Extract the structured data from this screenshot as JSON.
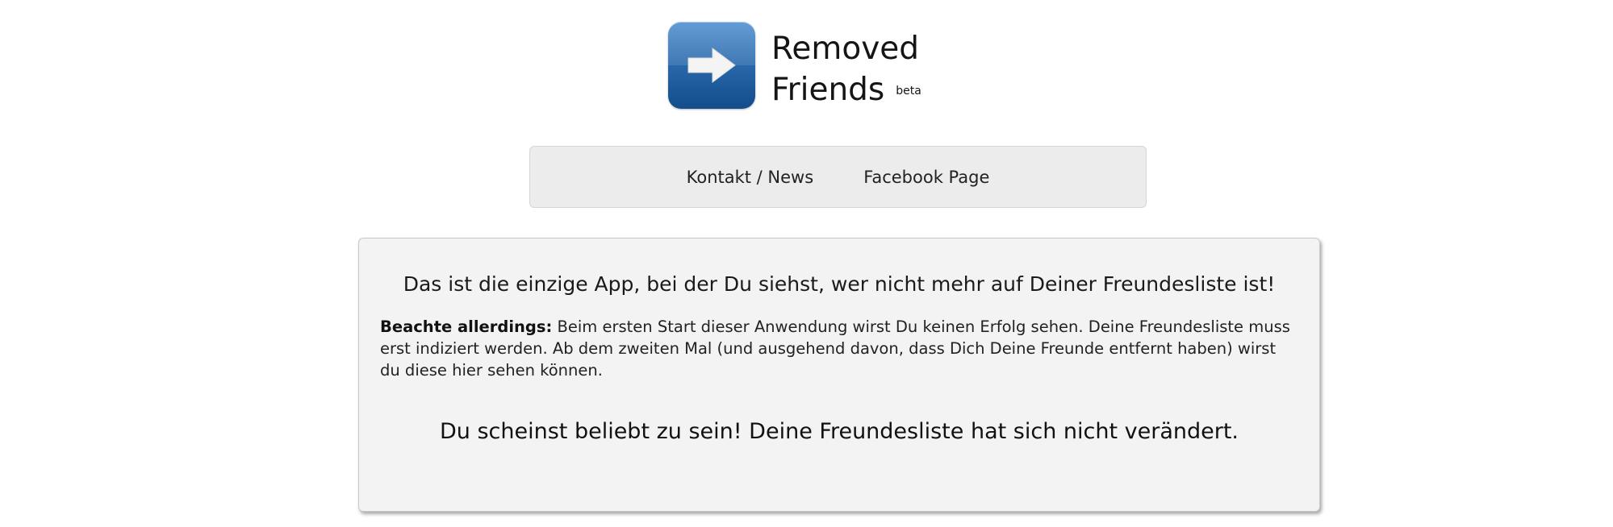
{
  "logo": {
    "icon": "right-arrow-icon",
    "line1": "Removed",
    "line2": "Friends",
    "badge": "beta",
    "icon_color": "#2a6aad"
  },
  "nav": {
    "items": [
      {
        "label": "Kontakt / News"
      },
      {
        "label": "Facebook Page"
      }
    ]
  },
  "panel": {
    "headline": "Das ist die einzige App, bei der Du siehst, wer nicht mehr auf Deiner Freundesliste ist!",
    "note_bold": "Beachte allerdings:",
    "note_text": "Beim ersten Start dieser Anwendung wirst Du keinen Erfolg sehen. Deine Freundesliste muss erst indiziert werden. Ab dem zweiten Mal (und ausgehend davon, dass Dich Deine Freunde entfernt haben) wirst du diese hier sehen können.",
    "status": "Du scheinst beliebt zu sein! Deine Freundesliste hat sich nicht verändert."
  }
}
